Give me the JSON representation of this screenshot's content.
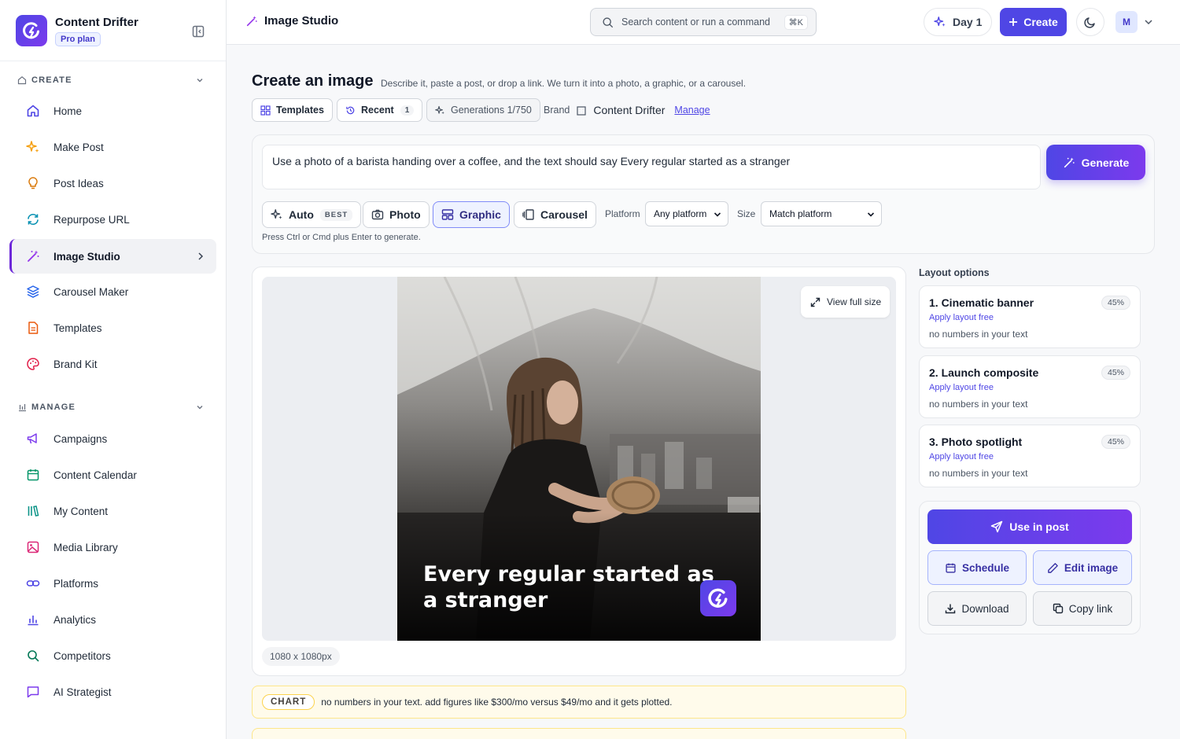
{
  "app": {
    "name": "Content Drifter",
    "plan": "Pro plan"
  },
  "sidebar": {
    "create_label": "CREATE",
    "manage_label": "MANAGE",
    "create_items": [
      {
        "label": "Home",
        "icon": "home-icon"
      },
      {
        "label": "Make Post",
        "icon": "sparkle-icon"
      },
      {
        "label": "Post Ideas",
        "icon": "lightbulb-icon"
      },
      {
        "label": "Repurpose URL",
        "icon": "refresh-icon"
      },
      {
        "label": "Image Studio",
        "icon": "magic-wand-icon",
        "active": true
      },
      {
        "label": "Carousel Maker",
        "icon": "layers-icon"
      },
      {
        "label": "Templates",
        "icon": "document-icon"
      },
      {
        "label": "Brand Kit",
        "icon": "palette-icon"
      }
    ],
    "manage_items": [
      {
        "label": "Campaigns",
        "icon": "megaphone-icon"
      },
      {
        "label": "Content Calendar",
        "icon": "calendar-icon"
      },
      {
        "label": "My Content",
        "icon": "library-icon"
      },
      {
        "label": "Media Library",
        "icon": "image-icon"
      },
      {
        "label": "Platforms",
        "icon": "link-icon"
      },
      {
        "label": "Analytics",
        "icon": "bar-chart-icon"
      },
      {
        "label": "Competitors",
        "icon": "search-icon"
      },
      {
        "label": "AI Strategist",
        "icon": "chat-icon"
      }
    ]
  },
  "topbar": {
    "title": "Image Studio",
    "search_placeholder": "Search content or run a command",
    "search_shortcut": "⌘K",
    "day_label": "Day 1",
    "create_label": "Create",
    "avatar_initial": "M"
  },
  "main": {
    "title": "Create an image",
    "subtitle": "Describe it, paste a post, or drop a link. We turn it into a photo, a graphic, or a carousel.",
    "chips": {
      "templates": "Templates",
      "recent": "Recent",
      "recent_count": "1",
      "generations": "Generations 1/750"
    },
    "brand_label": "Brand",
    "brand_name": "Content Drifter",
    "manage_label": "Manage"
  },
  "prompt": {
    "text": "Use a photo of a barista handing over a coffee, and the text should say Every regular started as a stranger",
    "generate_label": "Generate",
    "modes": {
      "auto": "Auto",
      "auto_badge": "BEST",
      "photo": "Photo",
      "graphic": "Graphic",
      "carousel": "Carousel"
    },
    "active_mode": "Graphic",
    "platform_label": "Platform",
    "platform_value": "Any platform",
    "size_label": "Size",
    "size_value": "Match platform",
    "hint": "Press Ctrl or Cmd plus Enter to generate."
  },
  "preview": {
    "caption_line1": "Every regular started as",
    "caption_line2": "a stranger",
    "view_full_label": "View full size",
    "dimensions": "1080 x 1080px"
  },
  "layout_options": {
    "title": "Layout options",
    "items": [
      {
        "name": "1. Cinematic banner",
        "score": "45%",
        "apply": "Apply layout free",
        "note": "no numbers in your text"
      },
      {
        "name": "2. Launch composite",
        "score": "45%",
        "apply": "Apply layout free",
        "note": "no numbers in your text"
      },
      {
        "name": "3. Photo spotlight",
        "score": "45%",
        "apply": "Apply layout free",
        "note": "no numbers in your text"
      }
    ]
  },
  "actions": {
    "use_in_post": "Use in post",
    "schedule": "Schedule",
    "edit_image": "Edit image",
    "download": "Download",
    "copy_link": "Copy link"
  },
  "chart_note": {
    "tag": "CHART",
    "message": "no numbers in your text. add figures like $300/mo versus $49/mo and it gets plotted."
  },
  "colors": {
    "accent": "#4f46e5",
    "accent_secondary": "#7c3aed",
    "active_nav_bar": "#6d28d9"
  }
}
